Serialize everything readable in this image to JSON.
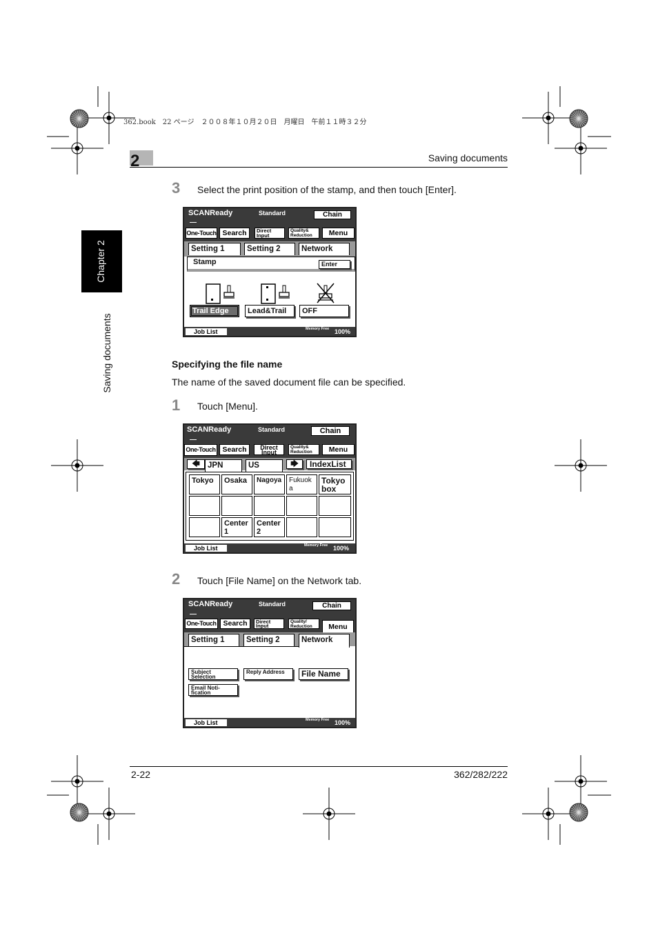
{
  "print_header": "362.book　22 ページ　２００８年１０月２０日　月曜日　午前１１時３２分",
  "chapter_number": "2",
  "section_title": "Saving documents",
  "side_tab": {
    "chapter": "Chapter 2",
    "section": "Saving documents"
  },
  "steps": [
    {
      "number": "3",
      "text": "Select the print position of the stamp, and then touch [Enter]."
    },
    {
      "number": "1",
      "text": "Touch [Menu]."
    },
    {
      "number": "2",
      "text": "Touch [File Name] on the Network tab."
    }
  ],
  "subheading": "Specifying the file name",
  "body_text": "The name of the saved document file can be specified.",
  "screen_common": {
    "status": "SCANReady",
    "mode": "Standard",
    "chain": "Chain",
    "one_touch": "One-Touch",
    "search": "Search",
    "direct_input": "Direct Input",
    "quality_reduction": "Quality& Reduction",
    "quality_reduction_alt": "Quality/ Reduction",
    "menu": "Menu",
    "job_list": "Job List",
    "memory_free": "Memory Free",
    "memory_pct": "100%"
  },
  "screen1": {
    "tabs": [
      "Setting 1",
      "Setting 2",
      "Network"
    ],
    "heading": "Stamp",
    "enter": "Enter",
    "options": [
      "Trail Edge",
      "Lead&Trail",
      "OFF"
    ],
    "icons": [
      "trail-edge-stamp-icon",
      "lead-trail-stamp-icon",
      "stamp-off-icon"
    ]
  },
  "screen2": {
    "tabs": [
      "JPN",
      "US"
    ],
    "index_list": "IndexList",
    "cells": [
      [
        "Tokyo",
        "Osaka",
        "Nagoya",
        "Fukuok a",
        "Tokyo box"
      ],
      [
        "",
        "",
        "",
        "",
        ""
      ],
      [
        "",
        "Center 1",
        "Center 2",
        "",
        ""
      ]
    ]
  },
  "screen3": {
    "tabs": [
      "Setting 1",
      "Setting 2",
      "Network"
    ],
    "buttons": [
      "Subject Selection",
      "Reply Address",
      "File Name",
      "Email Noti- fication"
    ]
  },
  "footer": {
    "page": "2-22",
    "model": "362/282/222"
  }
}
